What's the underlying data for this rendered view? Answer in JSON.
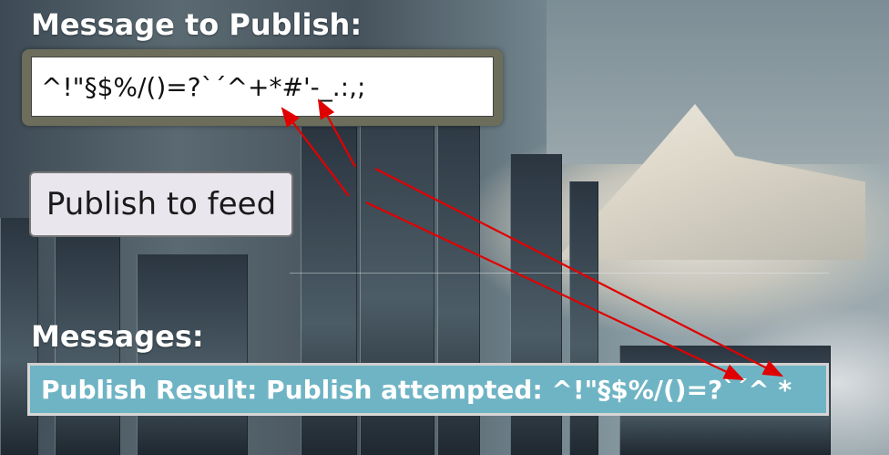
{
  "publish": {
    "label": "Message to Publish:",
    "input_value": "^!\"§$%/()=?`´^+*#'-_.:,;",
    "button_label": "Publish to feed"
  },
  "messages": {
    "label": "Messages:",
    "result_text": "Publish Result: Publish attempted: ^!\"§$%/()=?`´^ *"
  },
  "colors": {
    "result_background": "#6fb4c4",
    "annotation_arrows": "#e00000"
  }
}
